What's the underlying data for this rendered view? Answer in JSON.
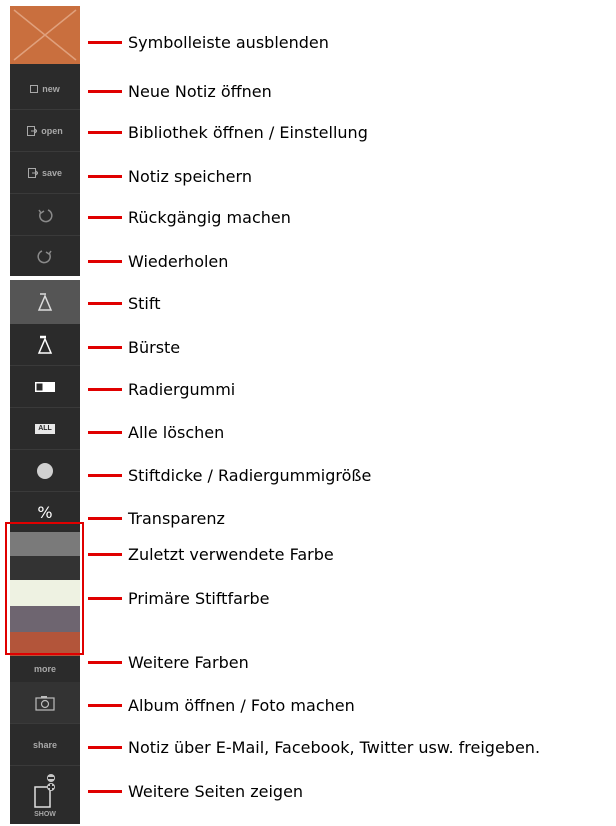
{
  "toolbar": {
    "new_label": "new",
    "open_label": "open",
    "save_label": "save",
    "more_label": "more",
    "share_label": "share",
    "show_label": "SHOW",
    "all_badge": "ALL",
    "percent_symbol": "%"
  },
  "swatches": [
    {
      "name": "recent-color-1",
      "color": "#7a7a7a"
    },
    {
      "name": "recent-color-2",
      "color": "#333333"
    },
    {
      "name": "primary-color",
      "color": "#eef2e2"
    },
    {
      "name": "color-4",
      "color": "#6e6570"
    },
    {
      "name": "color-5",
      "color": "#b3553a"
    }
  ],
  "colors": {
    "toolbar_bg": "#2b2b2b",
    "hide_button": "#c96f3e",
    "active_tool": "#555555",
    "annotation": "#e00000"
  },
  "annotations": [
    "Symbolleiste ausblenden",
    "Neue Notiz öffnen",
    "Bibliothek öffnen / Einstellung",
    "Notiz speichern",
    "Rückgängig machen",
    "Wiederholen",
    "Stift",
    "Bürste",
    "Radiergummi",
    "Alle löschen",
    "Stiftdicke / Radiergummigröße",
    "Transparenz",
    "Zuletzt verwendete Farbe",
    "Primäre Stiftfarbe",
    "Weitere Farben",
    "Album öffnen / Foto machen",
    "Notiz über E-Mail, Facebook, Twitter usw. freigeben.",
    "Weitere Seiten zeigen"
  ]
}
